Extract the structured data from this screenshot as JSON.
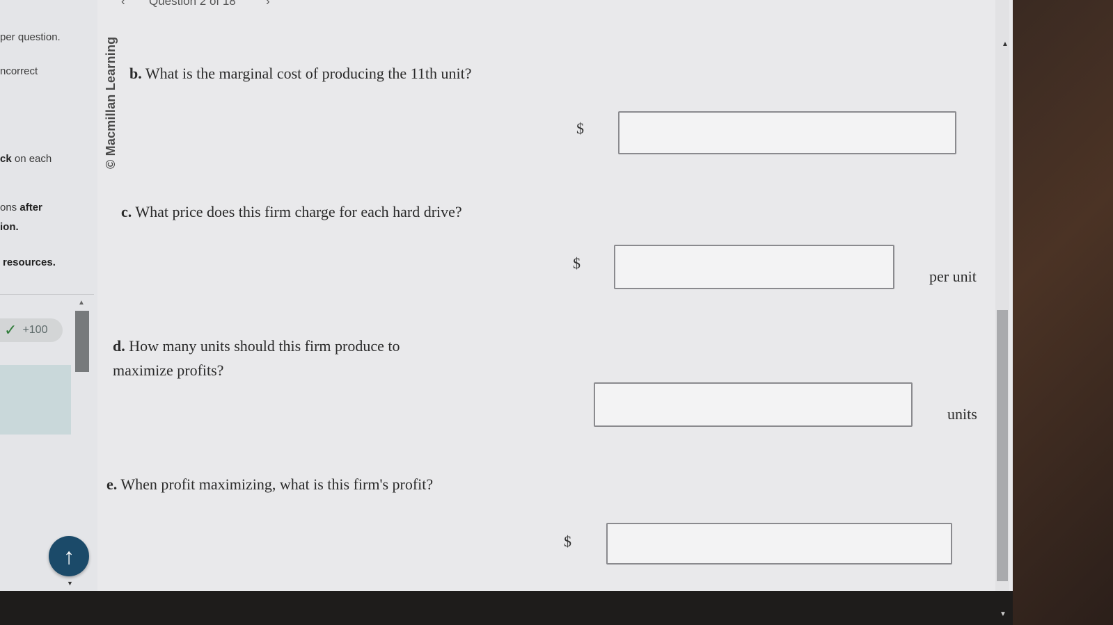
{
  "nav": {
    "prev_icon": "chevron-left-icon",
    "label": "Question 2 of 18",
    "next_icon": "chevron-right-icon"
  },
  "sidebar": {
    "line1": "per question.",
    "line2": "ncorrect",
    "line3_bold": "ck",
    "line3_rest": " on each",
    "line4_rest": "ons ",
    "line4_bold": "after",
    "line5": "ion.",
    "line6": "resources.",
    "score_icon": "checkmark-icon",
    "score": "+100",
    "scroll_top_icon": "arrow-up-icon"
  },
  "copyright": "© Macmillan Learning",
  "questions": [
    {
      "letter": "b.",
      "text": "What is the marginal cost of producing the 11th unit?",
      "prefix": "$",
      "suffix": ""
    },
    {
      "letter": "c.",
      "text": "What price does this firm charge for each hard drive?",
      "prefix": "$",
      "suffix": "per unit"
    },
    {
      "letter": "d.",
      "text": "How many units should this firm produce to maximize profits?",
      "prefix": "",
      "suffix": "units"
    },
    {
      "letter": "e.",
      "text": "When profit maximizing, what is this firm's profit?",
      "prefix": "$",
      "suffix": ""
    }
  ],
  "colors": {
    "screen_bg": "#e9e9eb",
    "check_green": "#2f7c39",
    "up_button": "#1b4a69"
  }
}
